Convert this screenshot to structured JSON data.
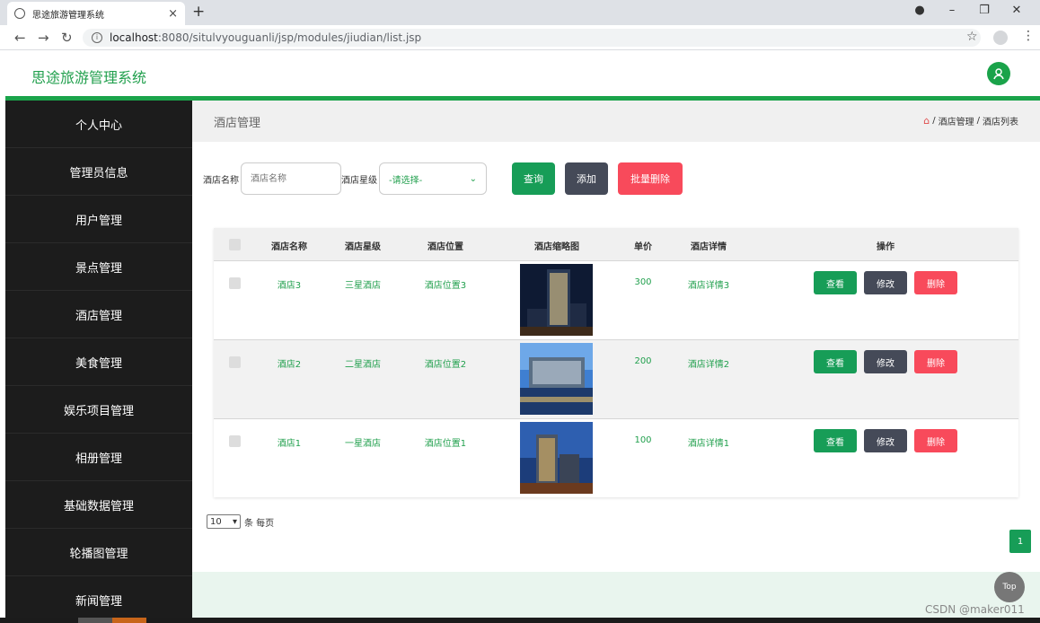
{
  "browser": {
    "tab_title": "思途旅游管理系统",
    "tab_close": "×",
    "new_tab": "+",
    "url_host": "localhost",
    "url_path": ":8080/situlvyouguanli/jsp/modules/jiudian/list.jsp"
  },
  "app": {
    "title": "思途旅游管理系统",
    "accent_color": "#1aa34a"
  },
  "sidebar": {
    "items": [
      {
        "label": "个人中心"
      },
      {
        "label": "管理员信息"
      },
      {
        "label": "用户管理"
      },
      {
        "label": "景点管理"
      },
      {
        "label": "酒店管理"
      },
      {
        "label": "美食管理"
      },
      {
        "label": "娱乐项目管理"
      },
      {
        "label": "相册管理"
      },
      {
        "label": "基础数据管理"
      },
      {
        "label": "轮播图管理"
      },
      {
        "label": "新闻管理"
      }
    ]
  },
  "page": {
    "title": "酒店管理",
    "breadcrumb": [
      "酒店管理",
      "酒店列表"
    ],
    "breadcrumb_sep": "/"
  },
  "search": {
    "name_label": "酒店名称",
    "name_placeholder": "酒店名称",
    "star_label": "酒店星级",
    "star_selected": "-请选择-",
    "query_button": "查询",
    "add_button": "添加",
    "bulk_delete_button": "批量删除"
  },
  "table": {
    "columns": [
      "酒店名称",
      "酒店星级",
      "酒店位置",
      "酒店缩略图",
      "单价",
      "酒店详情",
      "操作"
    ],
    "rows": [
      {
        "name": "酒店3",
        "star": "三星酒店",
        "location": "酒店位置3",
        "price": "300",
        "detail": "酒店详情3",
        "thumb": "hotel-3"
      },
      {
        "name": "酒店2",
        "star": "二星酒店",
        "location": "酒店位置2",
        "price": "200",
        "detail": "酒店详情2",
        "thumb": "hotel-2"
      },
      {
        "name": "酒店1",
        "star": "一星酒店",
        "location": "酒店位置1",
        "price": "100",
        "detail": "酒店详情1",
        "thumb": "hotel-1"
      }
    ],
    "actions": {
      "view": "查看",
      "edit": "修改",
      "delete": "删除"
    }
  },
  "pagination": {
    "page_size": "10",
    "page_size_suffix": "条 每页",
    "current_page": "1"
  },
  "top_button": "Top",
  "watermark": "CSDN @maker011"
}
